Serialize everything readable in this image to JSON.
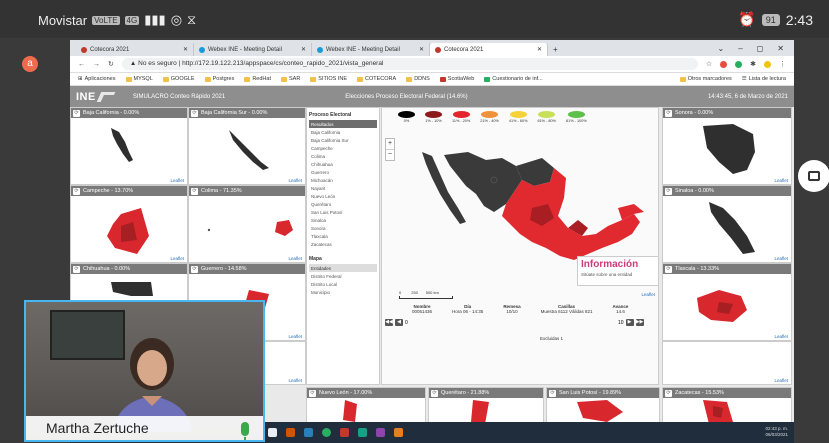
{
  "status_bar": {
    "carrier": "Movistar",
    "chip1": "VoLTE",
    "chip2": "4G",
    "time": "2:43",
    "battery": "91"
  },
  "browser": {
    "tabs": [
      {
        "title": "Cotecora 2021",
        "color": "#c0392b",
        "active": false
      },
      {
        "title": "Webex INE - Meeting Detail",
        "color": "#1a9bd7",
        "active": false
      },
      {
        "title": "Webex INE - Meeting Detail",
        "color": "#1a9bd7",
        "active": false
      },
      {
        "title": "Cotecora 2021",
        "color": "#c0392b",
        "active": true
      }
    ],
    "new_tab": "+",
    "window_controls": [
      "⌄",
      "–",
      "◻",
      "✕"
    ],
    "address": {
      "security": "No es seguro",
      "url": "http://172.19.122.213/appspace/cs/conteo_rapido_2021/vista_general"
    },
    "bookmarks": [
      "Aplicaciones",
      "MYSQL",
      "GOOGLE",
      "Postgres",
      "RedHat",
      "SAR",
      "SITIOS INE",
      "COTECORA",
      "DDNS",
      "ScotiaWeb",
      "Cuestionario de inf..."
    ],
    "bookmarks_right": [
      "Otros marcadores",
      "Lista de lectura"
    ]
  },
  "app": {
    "logo": "INE",
    "subtitle": "SIMULACRO Conteo Rápido 2021",
    "title": "Elecciones Proceso Electoral Federal (14.6%)",
    "datetime": "14:43:45, 6 de Marzo de 2021"
  },
  "left_panels": [
    {
      "label": "Baja California - 0.00%"
    },
    {
      "label": "Baja California Sur - 0.00%"
    },
    {
      "label": "Campeche - 13.70%"
    },
    {
      "label": "Colima - 71.35%"
    },
    {
      "label": "Chihuahua - 0.00%"
    },
    {
      "label": "Guerrero - 14.58%"
    }
  ],
  "right_panels": [
    {
      "label": "Sonora - 0.00%"
    },
    {
      "label": "Sinaloa - 0.00%"
    },
    {
      "label": "Tlaxcala - 13.33%"
    }
  ],
  "bottom_panels": [
    {
      "label": "Nuevo León - 17.00%"
    },
    {
      "label": "Querétaro - 21.88%"
    },
    {
      "label": "San Luis Potosí - 19.89%"
    },
    {
      "label": "Zacatecas - 15.53%"
    }
  ],
  "leaflet_label": "Leaflet",
  "sidebar": {
    "head1": "Proceso Electoral",
    "items": [
      "Resultados",
      "Baja California",
      "Baja California Sur",
      "Campeche",
      "Colima",
      "Chihuahua",
      "Guerrero",
      "Michoacán",
      "Nayarit",
      "Nuevo León",
      "Querétaro",
      "San Luis Potosí",
      "Sinaloa",
      "Sonora",
      "Tlaxcala",
      "Zacatecas"
    ],
    "head2": "Mapa",
    "map_items": [
      "Entidades",
      "Distrito Federal",
      "Distrito Local",
      "Municipio"
    ]
  },
  "main_map": {
    "legend": [
      {
        "label": "0%",
        "color": "#000000"
      },
      {
        "label": "1% - 10%",
        "color": "#8e1b1b"
      },
      {
        "label": "11% - 20%",
        "color": "#e3242b"
      },
      {
        "label": "21% - 40%",
        "color": "#f0913b"
      },
      {
        "label": "41% - 60%",
        "color": "#f6d23a"
      },
      {
        "label": "61% - 80%",
        "color": "#c6e05a"
      },
      {
        "label": "81% - 100%",
        "color": "#5cc04a"
      }
    ],
    "zoom_in": "+",
    "zoom_out": "−",
    "info_title": "Información",
    "info_sub": "Sitúate sobre una entidad",
    "scale_labels": [
      "0",
      "250",
      "500 km"
    ],
    "stats": [
      {
        "h": "Nombre",
        "v": "00051436"
      },
      {
        "h": "Día",
        "v": "Hora 06 - 14:35"
      },
      {
        "h": "Remesa",
        "v": "10/10"
      },
      {
        "h": "Casillas",
        "v": "Muestra 6112 Válidas 821"
      },
      {
        "h": "Avance",
        "v": "14.6"
      }
    ],
    "extra": "Excluidas 1",
    "page_left": "0",
    "page_right": "10"
  },
  "taskbar": {
    "time": "02:43 p. m.",
    "date": "06/03/2021"
  },
  "camera": {
    "name": "Martha Zertuche"
  }
}
